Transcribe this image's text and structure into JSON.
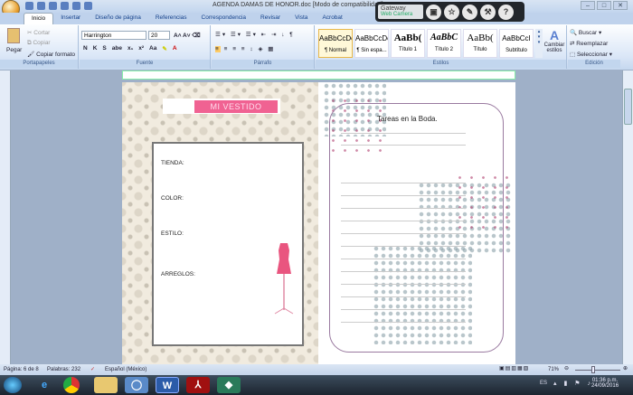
{
  "window": {
    "title": "AGENDA DAMAS DE HONOR.doc [Modo de compatibilidad]",
    "controls": [
      "–",
      "□",
      "✕"
    ]
  },
  "gateway": {
    "label": "Gateway",
    "sublabel": "Web Camera",
    "buttons": [
      "camera-icon",
      "star-icon",
      "edit-icon",
      "wrench-icon",
      "?"
    ]
  },
  "tabs": [
    "Inicio",
    "Insertar",
    "Diseño de página",
    "Referencias",
    "Correspondencia",
    "Revisar",
    "Vista",
    "Acrobat"
  ],
  "ribbon": {
    "clipboard": {
      "paste": "Pegar",
      "cut": "Cortar",
      "copy": "Copiar",
      "format_painter": "Copiar formato",
      "label": "Portapapeles"
    },
    "font": {
      "name": "Harrington",
      "size": "20",
      "label": "Fuente",
      "buttons": [
        "N",
        "K",
        "S",
        "abe",
        "x₁",
        "x²",
        "Aa"
      ]
    },
    "paragraph": {
      "label": "Párrafo"
    },
    "styles": {
      "items": [
        {
          "preview": "AaBbCcDc",
          "name": "¶ Normal"
        },
        {
          "preview": "AaBbCcDc",
          "name": "¶ Sin espa..."
        },
        {
          "preview": "AaBb(",
          "name": "Título 1"
        },
        {
          "preview": "AaBbC",
          "name": "Título 2"
        },
        {
          "preview": "AaBb(",
          "name": "Título"
        },
        {
          "preview": "AaBbCcI",
          "name": "Subtítulo"
        }
      ],
      "change": "Cambiar estilos",
      "label": "Estilos"
    },
    "editing": {
      "find": "Buscar",
      "replace": "Reemplazar",
      "select": "Seleccionar",
      "label": "Edición"
    }
  },
  "document": {
    "left_page": {
      "title": "MI VESTIDO",
      "fields": [
        "TIENDA:",
        "COLOR:",
        "ESTILO:",
        "ARREGLOS:"
      ]
    },
    "right_page": {
      "title": "Tareas en la Boda."
    }
  },
  "status": {
    "page": "Página: 6 de 8",
    "words": "Palabras: 232",
    "language": "Español (México)",
    "zoom": "71%"
  },
  "taskbar": {
    "lang": "ES",
    "time": "01:36 p.m.",
    "date": "24/09/2016"
  },
  "colors": {
    "accent_pink": "#f06292",
    "ribbon": "#dbe7f7"
  }
}
